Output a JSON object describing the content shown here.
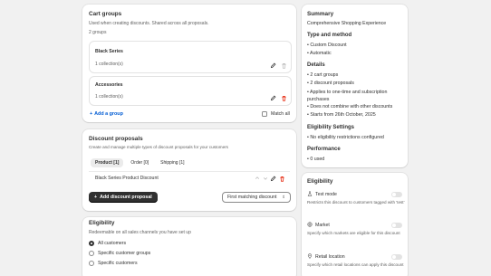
{
  "cart_groups": {
    "title": "Cart groups",
    "description": "Used when creating discounts. Shared across all proposals.",
    "count_text": "2 groups",
    "groups": [
      {
        "name": "Black Series",
        "collections": "1 collection(s)"
      },
      {
        "name": "Accessories",
        "collections": "1 collection(s)"
      }
    ],
    "add_group_label": "Add a group",
    "match_all_label": "Match all"
  },
  "discount_proposals": {
    "title": "Discount proposals",
    "description": "Create and manage multiple types of discount proposals for your customers",
    "tabs": [
      "Product [1]",
      "Order [0]",
      "Shipping [1]"
    ],
    "proposal_name": "Black Series Product Discount",
    "add_label": "Add discount proposal",
    "select_value": "First matching discount"
  },
  "eligibility": {
    "title": "Eligibility",
    "description": "Redeemable on all sales channels you have set up",
    "options": [
      "All customers",
      "Specific customer groups",
      "Specific customers"
    ]
  },
  "summary": {
    "title": "Summary",
    "subtitle": "Comprehensive Shopping Experience",
    "type_heading": "Type and method",
    "type_items": [
      "Custom Discount",
      "Automatic"
    ],
    "details_heading": "Details",
    "details_items": [
      "2 cart groups",
      "2 discount proposals",
      "Applies to one-time and subscription purchases",
      "Does not combine with other discounts",
      "Starts from 26th October, 2025"
    ],
    "eligibility_settings_heading": "Eligibility Settings",
    "eligibility_settings_items": [
      "No eligibility restrictions configured"
    ],
    "performance_heading": "Performance",
    "performance_items": [
      "0 used"
    ]
  },
  "side_eligibility": {
    "title": "Eligibility",
    "items": [
      {
        "label": "Test mode",
        "description": "Restricts this discount to customers tagged with 'test'"
      },
      {
        "label": "Market",
        "description": "Specify which markets are eligible for this discount"
      },
      {
        "label": "Retail location",
        "description": "Specify which retail locations can apply this discount"
      }
    ]
  },
  "colors": {
    "accent": "#005bd3",
    "danger": "#e51c00",
    "button_dark": "#303030"
  }
}
